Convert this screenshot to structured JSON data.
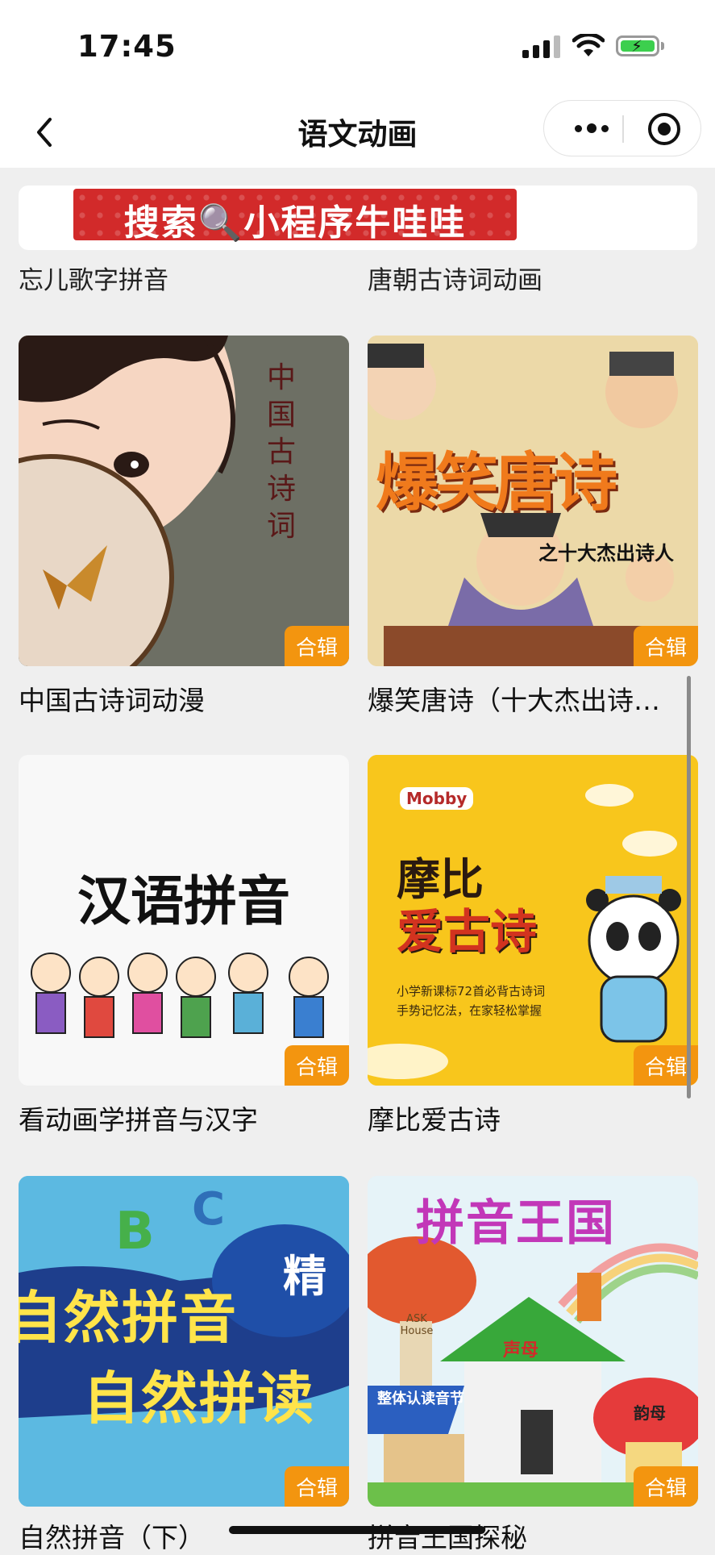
{
  "status_bar": {
    "time": "17:45"
  },
  "nav": {
    "title": "语文动画"
  },
  "banner": {
    "text": "搜索🔍小程序牛哇哇"
  },
  "partial_row": [
    {
      "title": "忘儿歌字拼音"
    },
    {
      "title": "唐朝古诗词动画"
    }
  ],
  "cards": [
    {
      "title": "中国古诗词动漫",
      "tag": "合辑",
      "image_text": "中国古诗词"
    },
    {
      "title": "爆笑唐诗（十大杰出诗…",
      "tag": "合辑",
      "image_text": "爆笑唐诗",
      "image_subtext": "之十大杰出诗人"
    },
    {
      "title": "看动画学拼音与汉字",
      "tag": "合辑",
      "image_text": "汉语拼音"
    },
    {
      "title": "摩比爱古诗",
      "tag": "合辑",
      "image_brand": "Mobby",
      "image_text_1": "摩比",
      "image_text_2": "爱古诗",
      "image_note_1": "小学新课标72首必背古诗词",
      "image_note_2": "手势记忆法，在家轻松掌握"
    },
    {
      "title": "自然拼音（下）",
      "tag": "合辑",
      "image_text_1": "自然拼音",
      "image_text_2": "自然拼读",
      "image_text_3": "精"
    },
    {
      "title": "拼音王国探秘",
      "tag": "合辑",
      "image_text": "拼音王国",
      "image_label_1": "声母",
      "image_label_2": "整体认读音节",
      "image_label_3": "韵母",
      "image_label_4": "ASK House"
    }
  ],
  "colors": {
    "tag_bg": "#f3950f",
    "nav_bg": "#ffffff",
    "page_bg": "#efefef"
  }
}
